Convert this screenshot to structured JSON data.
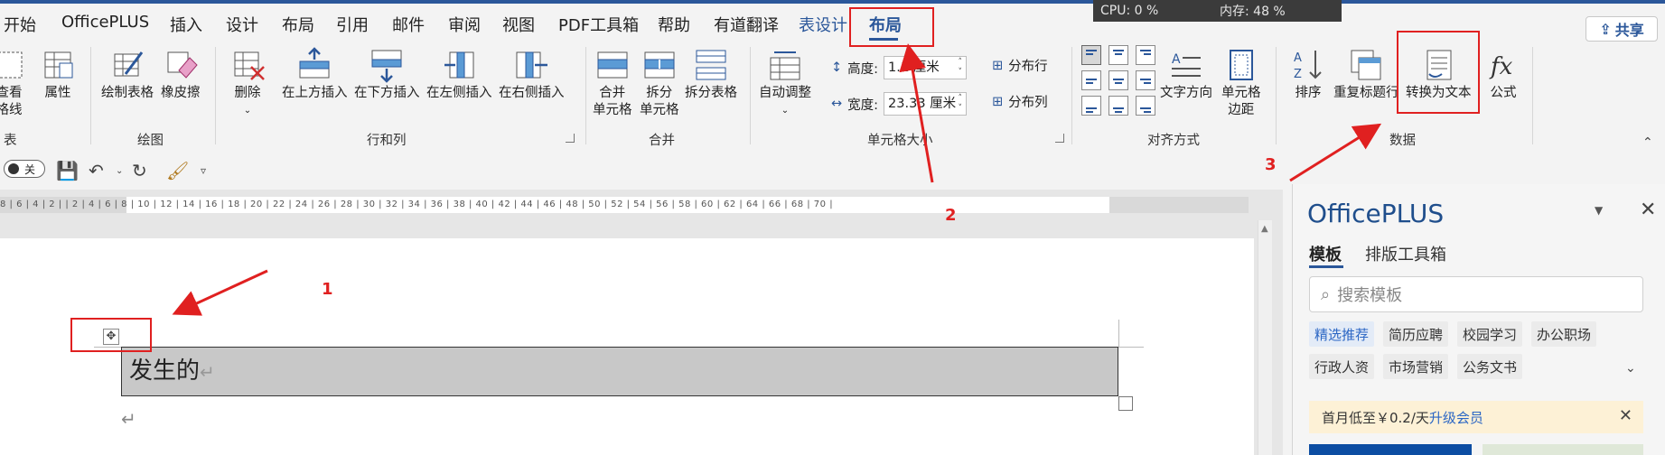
{
  "system": {
    "cpu": "CPU: 0 %",
    "mem": "内存: 48 %"
  },
  "tabs": [
    "开始",
    "OfficePLUS",
    "插入",
    "设计",
    "布局",
    "引用",
    "邮件",
    "审阅",
    "视图",
    "PDF工具箱",
    "帮助",
    "有道翻译",
    "表设计",
    "布局"
  ],
  "share": "共享",
  "ribbon": {
    "view_gridlines": "查看\n格线",
    "properties": "属性",
    "group_table": "表",
    "draw_table": "绘制表格",
    "eraser": "橡皮擦",
    "group_draw": "绘图",
    "delete": "删除",
    "insert_above": "在上方插入",
    "insert_below": "在下方插入",
    "insert_left": "在左侧插入",
    "insert_right": "在右侧插入",
    "group_rows_cols": "行和列",
    "merge_cells": "合并\n单元格",
    "split_cells": "拆分\n单元格",
    "split_table": "拆分表格",
    "group_merge": "合并",
    "autofit": "自动调整",
    "height_label": "高度:",
    "height_value": "1.1 厘米",
    "width_label": "宽度:",
    "width_value": "23.33 厘米",
    "distribute_rows": "分布行",
    "distribute_cols": "分布列",
    "group_cell_size": "单元格大小",
    "text_direction": "文字方向",
    "cell_margins": "单元格\n边距",
    "group_alignment": "对齐方式",
    "sort": "排序",
    "repeat_header": "重复标题行",
    "convert_to_text": "转换为文本",
    "formula": "公式",
    "group_data": "数据"
  },
  "qat": {
    "toggle": "关"
  },
  "ruler": "8 | 6 | 4 | 2 |  | 2 | 4 | 6 | 8 | 10 | 12 | 14 | 16 | 18 | 20 | 22 | 24 | 26 | 28 | 30 | 32 | 34 | 36 | 38 | 40 | 42 | 44 | 46 | 48 | 50 | 52 | 54 | 56 | 58 | 60 | 62 | 64 | 66 | 68 | 70 |",
  "document": {
    "cell_text": "发生的",
    "para_mark": "↵"
  },
  "panel": {
    "title": "OfficePLUS",
    "tabs": [
      "模板",
      "排版工具箱"
    ],
    "search_placeholder": "搜索模板",
    "chips": [
      "精选推荐",
      "简历应聘",
      "校园学习",
      "办公职场",
      "行政人资",
      "市场营销",
      "公务文书"
    ],
    "promo_text": "首月低至￥0.2/天",
    "promo_link": "升级会员"
  },
  "annotations": {
    "label1": "1",
    "label2": "2",
    "label3": "3"
  }
}
